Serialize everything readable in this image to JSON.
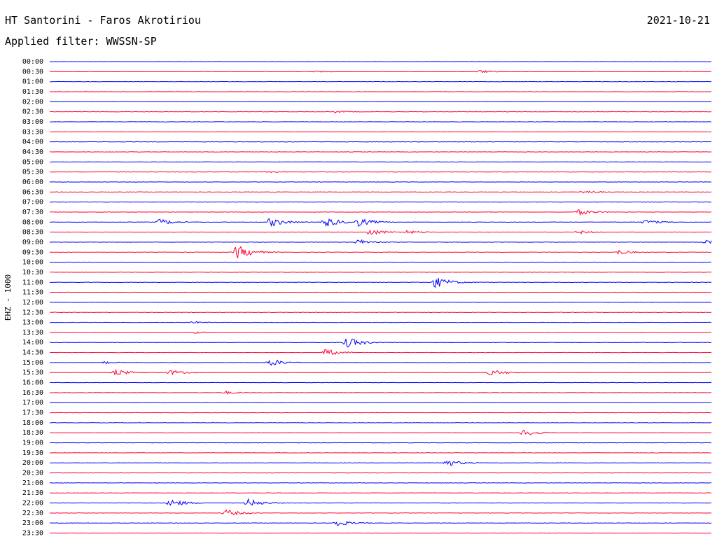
{
  "header": {
    "station": "HT Santorini - Faros Akrotiriou",
    "date": "2021-10-21",
    "filter": "Applied filter: WWSSN-SP"
  },
  "chart_data": {
    "type": "line",
    "subtype": "helicorder",
    "ylabel": "EHZ - 1000",
    "row_times": [
      "00:00",
      "00:30",
      "01:00",
      "01:30",
      "02:00",
      "02:30",
      "03:00",
      "03:30",
      "04:00",
      "04:30",
      "05:00",
      "05:30",
      "06:00",
      "06:30",
      "07:00",
      "07:30",
      "08:00",
      "08:30",
      "09:00",
      "09:30",
      "10:00",
      "10:30",
      "11:00",
      "11:30",
      "12:00",
      "12:30",
      "13:00",
      "13:30",
      "14:00",
      "14:30",
      "15:00",
      "15:30",
      "16:00",
      "16:30",
      "17:00",
      "17:30",
      "18:00",
      "18:30",
      "19:00",
      "19:30",
      "20:00",
      "20:30",
      "21:00",
      "21:30",
      "22:00",
      "22:30",
      "23:00",
      "23:30"
    ],
    "row_colors": [
      "#0000ff",
      "#ff0033"
    ],
    "row_duration_minutes": 30,
    "events": [
      {
        "row": 1,
        "minute": 12.0,
        "amplitude": 0.3
      },
      {
        "row": 1,
        "minute": 19.5,
        "amplitude": 0.5
      },
      {
        "row": 5,
        "minute": 13.0,
        "amplitude": 0.4
      },
      {
        "row": 11,
        "minute": 10.0,
        "amplitude": 0.3
      },
      {
        "row": 13,
        "minute": 24.2,
        "amplitude": 0.7
      },
      {
        "row": 15,
        "minute": 24.0,
        "amplitude": 1.0
      },
      {
        "row": 16,
        "minute": 5.0,
        "amplitude": 1.0
      },
      {
        "row": 16,
        "minute": 10.0,
        "amplitude": 1.5
      },
      {
        "row": 16,
        "minute": 12.5,
        "amplitude": 1.6
      },
      {
        "row": 16,
        "minute": 14.0,
        "amplitude": 1.4
      },
      {
        "row": 16,
        "minute": 27.0,
        "amplitude": 0.8
      },
      {
        "row": 17,
        "minute": 14.5,
        "amplitude": 1.2
      },
      {
        "row": 17,
        "minute": 16.2,
        "amplitude": 0.7
      },
      {
        "row": 17,
        "minute": 24.0,
        "amplitude": 0.6
      },
      {
        "row": 18,
        "minute": 14.0,
        "amplitude": 0.9
      },
      {
        "row": 18,
        "minute": 29.8,
        "amplitude": 1.0
      },
      {
        "row": 19,
        "minute": 8.5,
        "amplitude": 2.3
      },
      {
        "row": 19,
        "minute": 25.8,
        "amplitude": 0.8
      },
      {
        "row": 22,
        "minute": 17.5,
        "amplitude": 1.8
      },
      {
        "row": 26,
        "minute": 6.5,
        "amplitude": 0.4
      },
      {
        "row": 27,
        "minute": 6.5,
        "amplitude": 0.4
      },
      {
        "row": 28,
        "minute": 13.5,
        "amplitude": 1.7
      },
      {
        "row": 29,
        "minute": 12.5,
        "amplitude": 1.2
      },
      {
        "row": 30,
        "minute": 10.0,
        "amplitude": 1.2
      },
      {
        "row": 30,
        "minute": 2.5,
        "amplitude": 0.4
      },
      {
        "row": 31,
        "minute": 3.0,
        "amplitude": 1.0
      },
      {
        "row": 31,
        "minute": 5.5,
        "amplitude": 0.8
      },
      {
        "row": 31,
        "minute": 20.0,
        "amplitude": 1.0
      },
      {
        "row": 33,
        "minute": 8.0,
        "amplitude": 0.5
      },
      {
        "row": 37,
        "minute": 21.5,
        "amplitude": 1.1
      },
      {
        "row": 40,
        "minute": 18.0,
        "amplitude": 1.2
      },
      {
        "row": 44,
        "minute": 5.5,
        "amplitude": 1.3
      },
      {
        "row": 44,
        "minute": 9.0,
        "amplitude": 1.3
      },
      {
        "row": 45,
        "minute": 8.0,
        "amplitude": 1.1
      },
      {
        "row": 46,
        "minute": 13.0,
        "amplitude": 1.1
      }
    ]
  }
}
